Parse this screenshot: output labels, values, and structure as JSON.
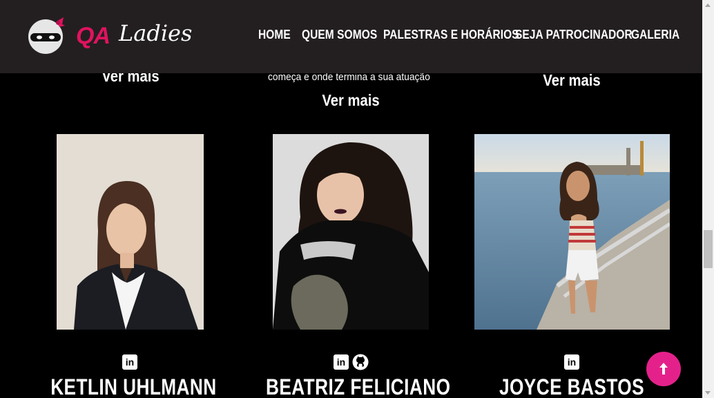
{
  "header": {
    "logo": {
      "qa": "QA",
      "ladies": "Ladies"
    },
    "nav": [
      {
        "label": "HOME"
      },
      {
        "label": "QUEM SOMOS"
      },
      {
        "label": "PALESTRAS E HORÁRIOS"
      },
      {
        "label": "SEJA PATROCINADOR"
      },
      {
        "label": "GALERIA"
      }
    ]
  },
  "previous_row": {
    "left_link": "Ver mais",
    "middle_desc_tail": "começa e onde termina a sua atuação",
    "middle_link": "Ver mais",
    "right_link": "Ver mais"
  },
  "speakers": [
    {
      "name": "KETLIN UHLMANN",
      "social": [
        "linkedin-icon"
      ]
    },
    {
      "name": "BEATRIZ FELICIANO",
      "social": [
        "linkedin-icon",
        "github-icon"
      ]
    },
    {
      "name": "JOYCE BASTOS",
      "social": [
        "linkedin-icon"
      ]
    }
  ],
  "icons": {
    "linkedin_text": "in"
  },
  "colors": {
    "header_bg": "#231f20",
    "brand_pink": "#e0135f",
    "back_to_top": "#e4218b",
    "page_bg": "#000000"
  }
}
